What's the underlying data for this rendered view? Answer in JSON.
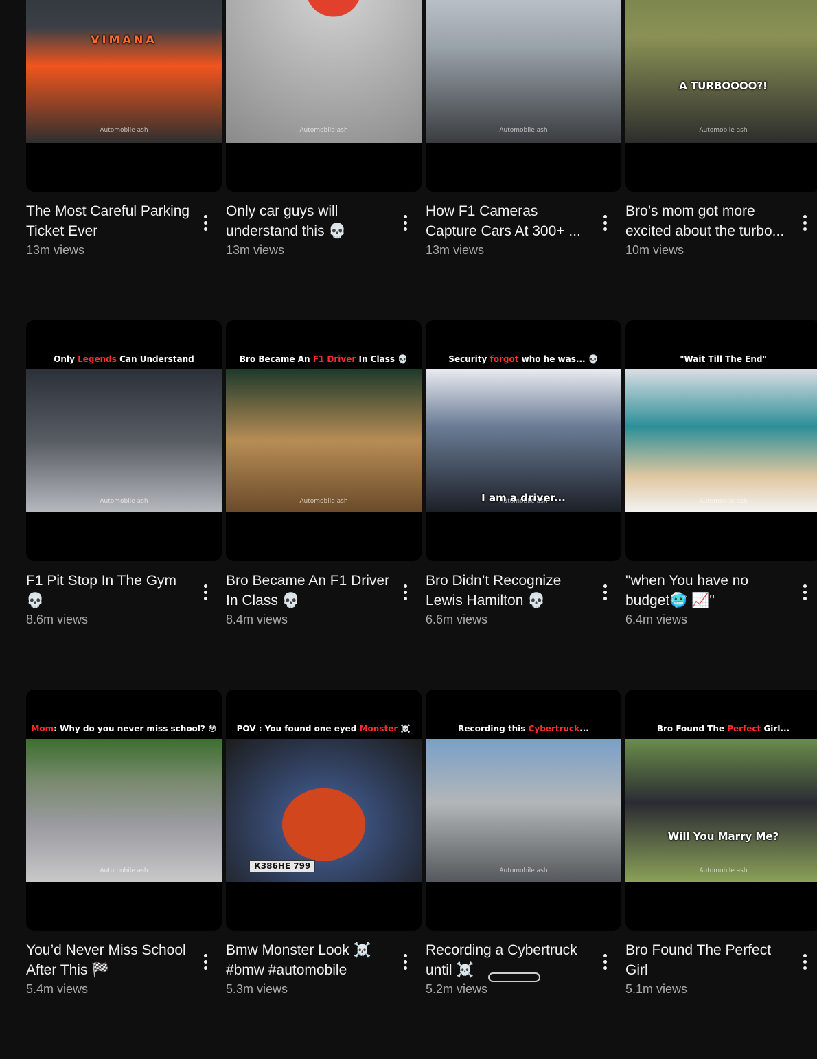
{
  "videos": [
    {
      "title": "The Most Careful Parking Ticket Ever",
      "views": "13m views",
      "caption_pre": "",
      "caption_hl": "",
      "caption_post": "",
      "overlay": "VIMANA",
      "watermark": "Automobile ash"
    },
    {
      "title": "Only car guys will understand this 💀",
      "views": "13m views",
      "caption_pre": "",
      "caption_hl": "",
      "caption_post": "",
      "overlay": "",
      "watermark": "Automobile ash"
    },
    {
      "title": "How F1 Cameras Capture Cars At 300+ ...",
      "views": "13m views",
      "caption_pre": "",
      "caption_hl": "",
      "caption_post": "",
      "overlay": "",
      "watermark": "Automobile ash"
    },
    {
      "title": "Bro’s mom got more excited about the turbo...",
      "views": "10m views",
      "caption_pre": "",
      "caption_hl": "",
      "caption_post": "",
      "overlay": "A TURBOOOO?!",
      "watermark": "Automobile ash"
    },
    {
      "title": "F1 Pit Stop In The Gym 💀",
      "views": "8.6m views",
      "caption_pre": "Only ",
      "caption_hl": "Legends",
      "caption_post": " Can Understand",
      "overlay": "",
      "watermark": "Automobile ash"
    },
    {
      "title": "Bro Became An F1 Driver In Class 💀",
      "views": "8.4m views",
      "caption_pre": "Bro Became An ",
      "caption_hl": "F1 Driver",
      "caption_post": " In Class 💀",
      "overlay": "",
      "watermark": "Automobile ash"
    },
    {
      "title": "Bro Didn’t Recognize Lewis Hamilton 💀",
      "views": "6.6m views",
      "caption_pre": "Security ",
      "caption_hl": "forgot",
      "caption_post": " who he was... 💀",
      "overlay": "I am a driver...",
      "watermark": "Automobile ash"
    },
    {
      "title": "\"when You have no budget🥶 📈\"",
      "views": "6.4m views",
      "caption_pre": "\"Wait Till The End\"",
      "caption_hl": "",
      "caption_post": "",
      "overlay": "",
      "watermark": "Automobile ash"
    },
    {
      "title": "You’d Never Miss School After This 🏁",
      "views": "5.4m views",
      "caption_pre": "",
      "caption_hl": "Mom",
      "caption_post": ": Why do you never miss school? 😳",
      "overlay": "",
      "watermark": "Automobile ash"
    },
    {
      "title": "Bmw Monster Look ☠️ #bmw #automobile",
      "views": "5.3m views",
      "caption_pre": "POV : You found one eyed ",
      "caption_hl": "Monster",
      "caption_post": " ☠️",
      "overlay": "К386НЕ 799",
      "watermark": ""
    },
    {
      "title": "Recording a Cybertruck until ☠️",
      "views": "5.2m views",
      "caption_pre": "Recording this ",
      "caption_hl": "Cybertruck",
      "caption_post": "...",
      "overlay": "",
      "watermark": "Automobile ash"
    },
    {
      "title": "Bro Found The Perfect Girl",
      "views": "5.1m views",
      "caption_pre": "Bro Found The ",
      "caption_hl": "Perfect",
      "caption_post": " Girl...",
      "overlay": "Will You Marry Me?",
      "watermark": "Automobile ash"
    }
  ],
  "icons": {
    "more": "more-vert-icon"
  }
}
